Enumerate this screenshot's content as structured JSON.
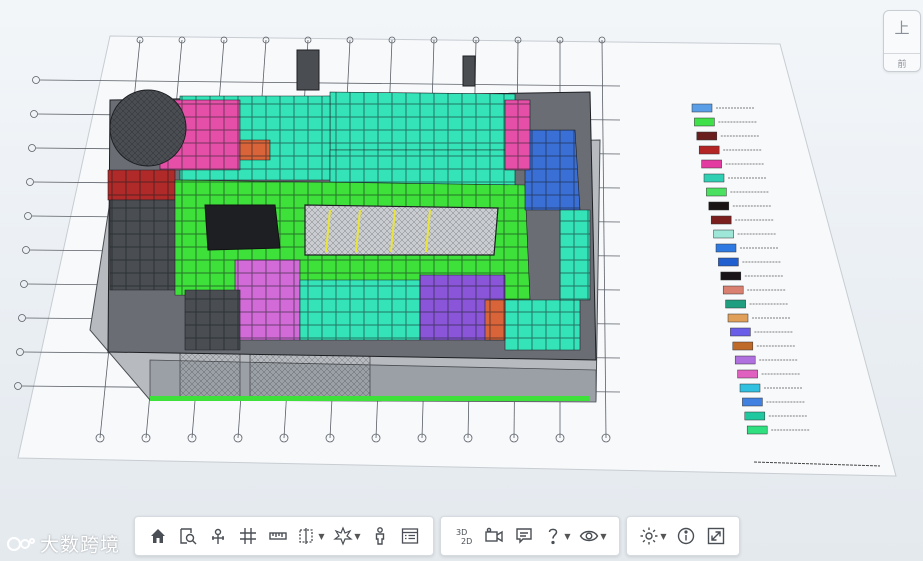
{
  "viewcube": {
    "top_face": "上",
    "front_face": "前"
  },
  "toolbar": {
    "groups": [
      [
        "home-icon",
        "zoom-box-icon",
        "section-icon",
        "grid-icon",
        "ruler-icon",
        "section-box-icon",
        "explode-icon",
        "person-icon",
        "properties-icon"
      ],
      [
        "view-2d3d-icon",
        "camera-icon",
        "comment-icon",
        "help-icon",
        "eye-icon"
      ],
      [
        "settings-icon",
        "info-icon",
        "fullscreen-icon"
      ]
    ]
  },
  "colors": {
    "teal": "#35e3b8",
    "green": "#3ee03a",
    "purple": "#8a55d8",
    "pink": "#e64fa8",
    "magenta": "#d26ad8",
    "blue": "#3a6fd6",
    "red": "#b02a2a",
    "orange": "#d9643a",
    "gray": "#b7bbbf",
    "dark": "#4a4d52",
    "black": "#1d1f23",
    "background": "#eef2f6"
  },
  "legend": {
    "swatches": [
      "#5a9ee8",
      "#3fe04a",
      "#6b1e1e",
      "#b32424",
      "#e23aa0",
      "#2fcfb4",
      "#4ae060",
      "#1a1414",
      "#7a1e1e",
      "#9de6d8",
      "#2f7ae2",
      "#1f5fd0",
      "#181418",
      "#d98070",
      "#1f9f80",
      "#e0a05a",
      "#6a5ee8",
      "#c06a2a",
      "#b070e0",
      "#e060c0",
      "#30c0e0",
      "#4080e0",
      "#20c8a0",
      "#30e080"
    ]
  },
  "watermark": {
    "text": "大数跨境"
  }
}
